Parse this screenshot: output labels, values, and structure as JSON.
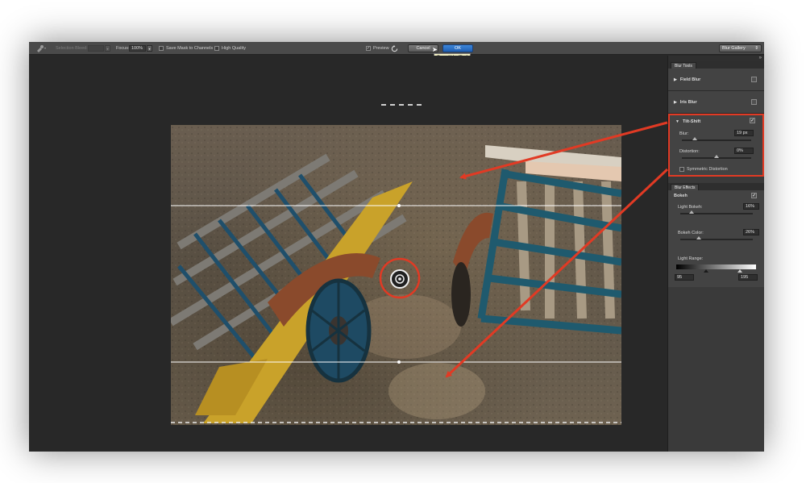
{
  "toolbar": {
    "selection_bleed_label": "Selection Bleed:",
    "focus_label": "Focus:",
    "focus_value": "100%",
    "save_mask_label": "Save Mask to Channels",
    "high_quality_label": "High Quality",
    "preview_label": "Preview",
    "cancel_label": "Cancel",
    "ok_label": "OK",
    "cancel_tooltip": "Cancel blur (Esc)",
    "gallery_label": "Blur Gallery"
  },
  "blur_tools": {
    "tab_label": "Blur Tools",
    "field_blur": "Field Blur",
    "iris_blur": "Iris Blur",
    "tilt_shift": "Tilt-Shift",
    "blur_label": "Blur:",
    "blur_value": "19 px",
    "blur_level": 0.19,
    "distortion_label": "Distortion:",
    "distortion_value": "0%",
    "distortion_level": 0.5,
    "symmetric_label": "Symmetric Distortion"
  },
  "blur_effects": {
    "tab_label": "Blur Effects",
    "bokeh_label": "Bokeh",
    "light_bokeh_label": "Light Bokeh:",
    "light_bokeh_value": "16%",
    "light_bokeh_level": 0.16,
    "bokeh_color_label": "Bokeh Color:",
    "bokeh_color_value": "26%",
    "bokeh_color_level": 0.26,
    "light_range_label": "Light Range:",
    "light_range_low": "95",
    "light_range_high": "195"
  },
  "colors": {
    "annotation": "#e13a24",
    "ok_button": "#2c6fc7",
    "tooltip_bg": "#f7f4c6"
  }
}
